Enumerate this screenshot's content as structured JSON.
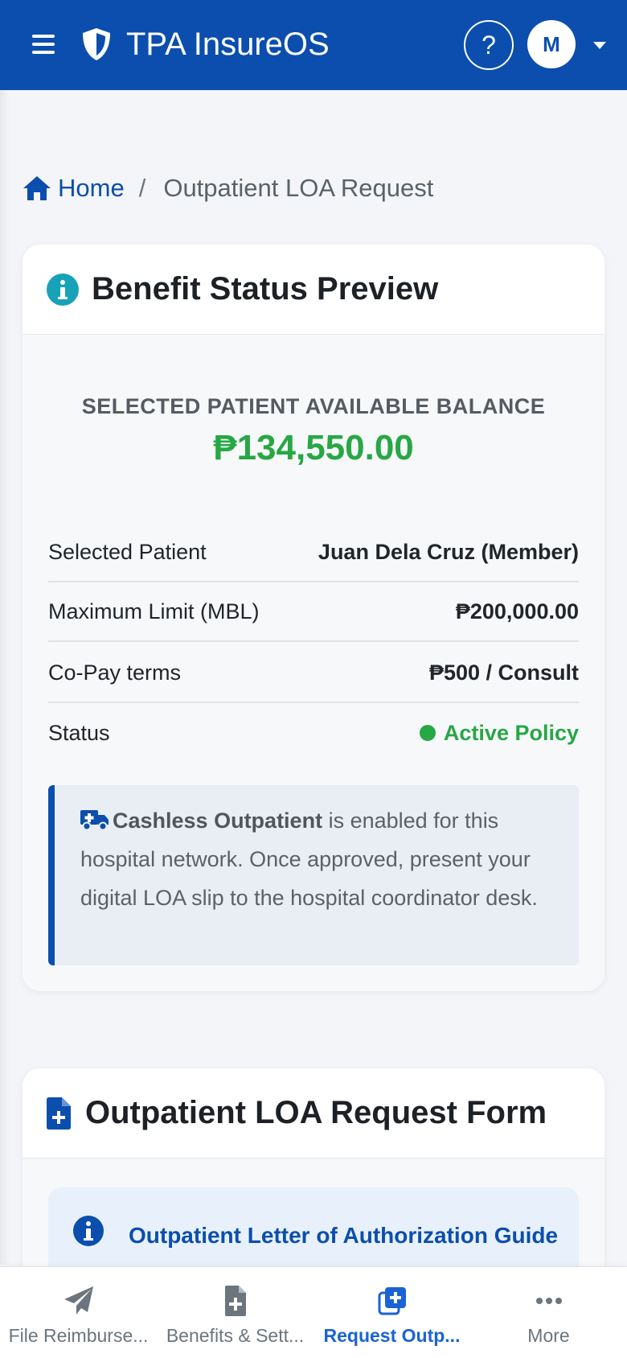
{
  "navbar": {
    "brand": "TPA InsureOS",
    "help_label": "?",
    "avatar_initial": "M"
  },
  "breadcrumb": {
    "home": "Home",
    "separator": "/",
    "current": "Outpatient LOA Request"
  },
  "benefit_card": {
    "title": "Benefit Status Preview",
    "balance_label": "SELECTED PATIENT AVAILABLE BALANCE",
    "balance_value": "₱134,550.00",
    "rows": [
      {
        "label": "Selected Patient",
        "value": "Juan Dela Cruz (Member)"
      },
      {
        "label": "Maximum Limit (MBL)",
        "value": "₱200,000.00"
      },
      {
        "label": "Co-Pay terms",
        "value": "₱500 / Consult"
      },
      {
        "label": "Status",
        "value": "Active Policy"
      }
    ],
    "alert": {
      "bold": "Cashless Outpatient",
      "text": " is enabled for this hospital network. Once approved, present your digital LOA slip to the hospital coordinator desk."
    }
  },
  "form_card": {
    "title": "Outpatient LOA Request Form",
    "guide_title": "Outpatient Letter of Authorization Guide"
  },
  "bottom_nav": {
    "items": [
      {
        "label": "File Reimburse...",
        "icon": "paper-plane-icon"
      },
      {
        "label": "Benefits & Sett...",
        "icon": "file-plus-icon"
      },
      {
        "label": "Request Outp...",
        "icon": "add-stack-icon"
      },
      {
        "label": "More",
        "icon": "more-dots-icon"
      }
    ]
  },
  "colors": {
    "primary": "#0b4ead",
    "success": "#28a745",
    "info": "#17a2b8"
  }
}
